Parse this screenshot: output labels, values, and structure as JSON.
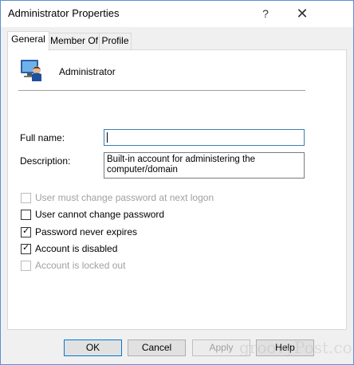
{
  "window": {
    "title": "Administrator Properties",
    "help_glyph": "?",
    "close_glyph": "✕"
  },
  "tabs": [
    {
      "label": "General",
      "active": true
    },
    {
      "label": "Member Of",
      "active": false
    },
    {
      "label": "Profile",
      "active": false
    }
  ],
  "general": {
    "user_name": "Administrator",
    "icon": "user-account-icon",
    "fields": {
      "full_name_label": "Full name:",
      "full_name_value": "",
      "description_label": "Description:",
      "description_value": "Built-in account for administering the computer/domain"
    },
    "options": [
      {
        "label": "User must change password at next logon",
        "checked": false,
        "enabled": false
      },
      {
        "label": "User cannot change password",
        "checked": false,
        "enabled": true
      },
      {
        "label": "Password never expires",
        "checked": true,
        "enabled": true
      },
      {
        "label": "Account is disabled",
        "checked": true,
        "enabled": true
      },
      {
        "label": "Account is locked out",
        "checked": false,
        "enabled": false
      }
    ]
  },
  "buttons": {
    "ok": "OK",
    "cancel": "Cancel",
    "apply": "Apply",
    "help": "Help"
  },
  "watermark": "groovyPost.com",
  "colors": {
    "window_border": "#5b8fd6",
    "focus_border": "#3c7fb1",
    "default_button_border": "#0078d7"
  }
}
